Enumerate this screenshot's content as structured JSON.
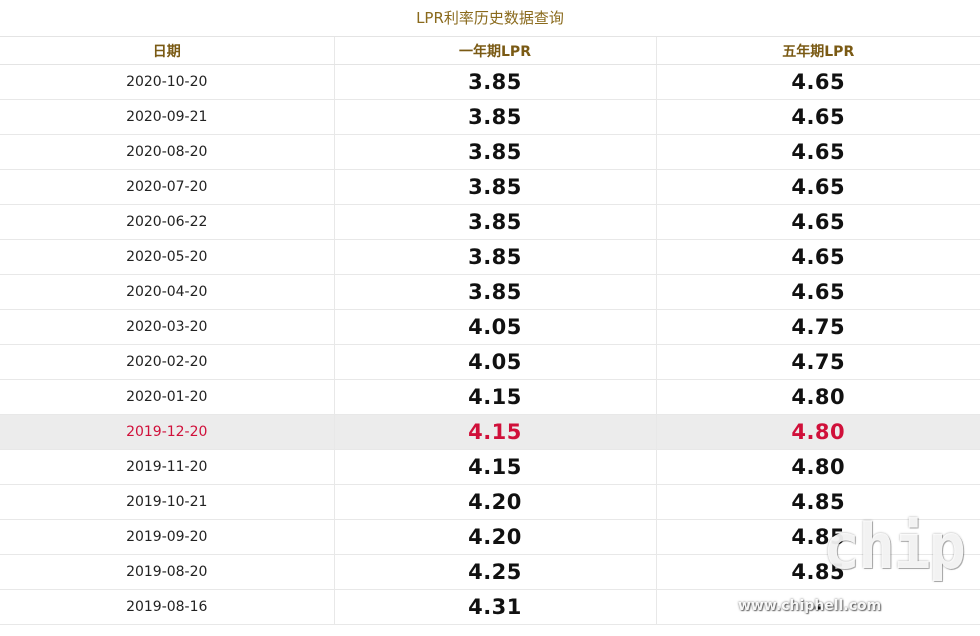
{
  "title": "LPR利率历史数据查询",
  "columns": [
    "日期",
    "一年期LPR",
    "五年期LPR"
  ],
  "rows": [
    {
      "date": "2020-10-20",
      "one_year": "3.85",
      "five_year": "4.65",
      "highlight": false
    },
    {
      "date": "2020-09-21",
      "one_year": "3.85",
      "five_year": "4.65",
      "highlight": false
    },
    {
      "date": "2020-08-20",
      "one_year": "3.85",
      "five_year": "4.65",
      "highlight": false
    },
    {
      "date": "2020-07-20",
      "one_year": "3.85",
      "five_year": "4.65",
      "highlight": false
    },
    {
      "date": "2020-06-22",
      "one_year": "3.85",
      "five_year": "4.65",
      "highlight": false
    },
    {
      "date": "2020-05-20",
      "one_year": "3.85",
      "five_year": "4.65",
      "highlight": false
    },
    {
      "date": "2020-04-20",
      "one_year": "3.85",
      "five_year": "4.65",
      "highlight": false
    },
    {
      "date": "2020-03-20",
      "one_year": "4.05",
      "five_year": "4.75",
      "highlight": false
    },
    {
      "date": "2020-02-20",
      "one_year": "4.05",
      "five_year": "4.75",
      "highlight": false
    },
    {
      "date": "2020-01-20",
      "one_year": "4.15",
      "five_year": "4.80",
      "highlight": false
    },
    {
      "date": "2019-12-20",
      "one_year": "4.15",
      "five_year": "4.80",
      "highlight": true
    },
    {
      "date": "2019-11-20",
      "one_year": "4.15",
      "five_year": "4.80",
      "highlight": false
    },
    {
      "date": "2019-10-21",
      "one_year": "4.20",
      "five_year": "4.85",
      "highlight": false
    },
    {
      "date": "2019-09-20",
      "one_year": "4.20",
      "five_year": "4.85",
      "highlight": false
    },
    {
      "date": "2019-08-20",
      "one_year": "4.25",
      "five_year": "4.85",
      "highlight": false
    },
    {
      "date": "2019-08-16",
      "one_year": "4.31",
      "five_year": "-",
      "highlight": false
    }
  ],
  "watermark": {
    "logo": "chiphell",
    "url": "www.chiphell.com"
  },
  "colors": {
    "title": "#8a6a1c",
    "header": "#7a5a14",
    "highlight_text": "#d0103a",
    "highlight_bg": "#ececec"
  }
}
